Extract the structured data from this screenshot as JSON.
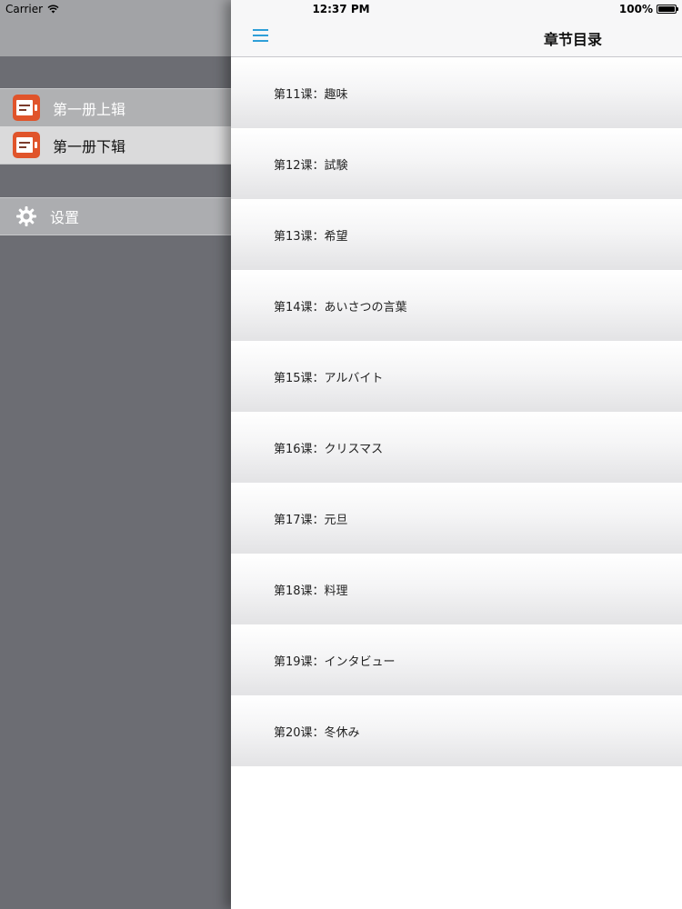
{
  "status_bar": {
    "carrier": "Carrier",
    "time": "12:37 PM",
    "battery": "100%"
  },
  "left_menu": {
    "items": [
      {
        "label": "第一册上辑",
        "icon": "book-icon"
      },
      {
        "label": "第一册下辑",
        "icon": "book-icon"
      }
    ],
    "settings": {
      "label": "设置",
      "icon": "gear-icon"
    }
  },
  "main": {
    "title": "章节目录",
    "lessons": [
      {
        "label": "第11课：趣味"
      },
      {
        "label": "第12课：試験"
      },
      {
        "label": "第13课：希望"
      },
      {
        "label": "第14课：あいさつの言葉"
      },
      {
        "label": "第15课：アルバイト"
      },
      {
        "label": "第16课：クリスマス"
      },
      {
        "label": "第17课：元旦"
      },
      {
        "label": "第18课：料理"
      },
      {
        "label": "第19课：インタビュー"
      },
      {
        "label": "第20课：冬休み"
      }
    ]
  },
  "colors": {
    "accent": "#2f9fd8",
    "book_icon": "#e0542b",
    "menu_background": "#6c6d73"
  }
}
